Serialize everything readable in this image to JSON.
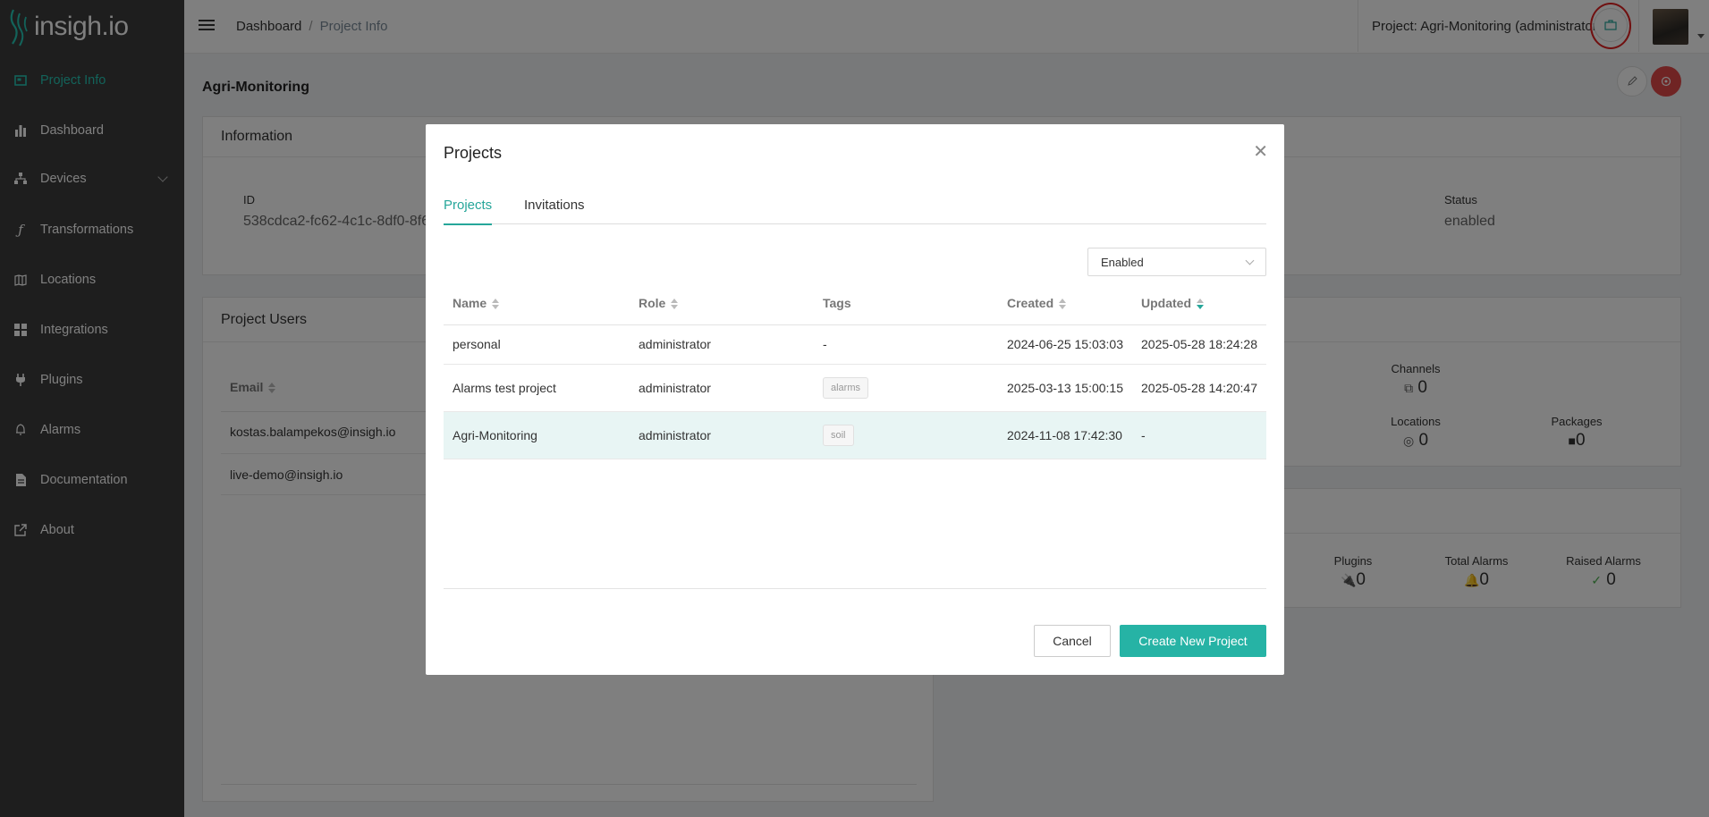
{
  "brand": {
    "name": "insigh.io"
  },
  "sidebar": {
    "items": [
      {
        "label": "Project Info",
        "icon": "project-info-icon"
      },
      {
        "label": "Dashboard",
        "icon": "bar-chart-icon"
      },
      {
        "label": "Devices",
        "icon": "devices-icon"
      },
      {
        "label": "Transformations",
        "icon": "function-icon"
      },
      {
        "label": "Locations",
        "icon": "map-icon"
      },
      {
        "label": "Integrations",
        "icon": "integrations-icon"
      },
      {
        "label": "Plugins",
        "icon": "plug-icon"
      },
      {
        "label": "Alarms",
        "icon": "bell-icon"
      },
      {
        "label": "Documentation",
        "icon": "document-icon"
      },
      {
        "label": "About",
        "icon": "external-link-icon"
      }
    ]
  },
  "header": {
    "breadcrumb": {
      "root": "Dashboard",
      "separator": "/",
      "current": "Project Info"
    },
    "project_label": "Project: Agri-Monitoring (administrator)"
  },
  "page": {
    "title": "Agri-Monitoring",
    "information": {
      "title": "Information",
      "id_label": "ID",
      "id_value": "538cdca2-fc62-4c1c-8df0-8f6",
      "status_label": "Status",
      "status_value": "enabled"
    },
    "users": {
      "title": "Project Users",
      "email_header": "Email",
      "emails": [
        "kostas.balampekos@insigh.io",
        "live-demo@insigh.io"
      ]
    },
    "stats1": [
      {
        "label": "Channels",
        "value": "0"
      },
      {
        "label": "Locations",
        "value": "0"
      },
      {
        "label": "Packages",
        "value": "0"
      }
    ],
    "stats2": [
      {
        "label": "Plugins",
        "value": "0"
      },
      {
        "label": "Total Alarms",
        "value": "0"
      },
      {
        "label": "Raised Alarms",
        "value": "0"
      }
    ]
  },
  "modal": {
    "title": "Projects",
    "tabs": [
      "Projects",
      "Invitations"
    ],
    "filter": {
      "selected": "Enabled"
    },
    "columns": [
      "Name",
      "Role",
      "Tags",
      "Created",
      "Updated"
    ],
    "rows": [
      {
        "name": "personal",
        "role": "administrator",
        "tag": "-",
        "created": "2024-06-25 15:03:03",
        "updated": "2025-05-28 18:24:28"
      },
      {
        "name": "Alarms test project",
        "role": "administrator",
        "tag": "alarms",
        "created": "2025-03-13 15:00:15",
        "updated": "2025-05-28 14:20:47"
      },
      {
        "name": "Agri-Monitoring",
        "role": "administrator",
        "tag": "soil",
        "created": "2024-11-08 17:42:30",
        "updated": "-"
      }
    ],
    "cancel_label": "Cancel",
    "create_label": "Create New Project"
  },
  "colors": {
    "accent": "#26b3a5",
    "sidebar": "#3c3c3c",
    "highlight": "#e02020"
  }
}
